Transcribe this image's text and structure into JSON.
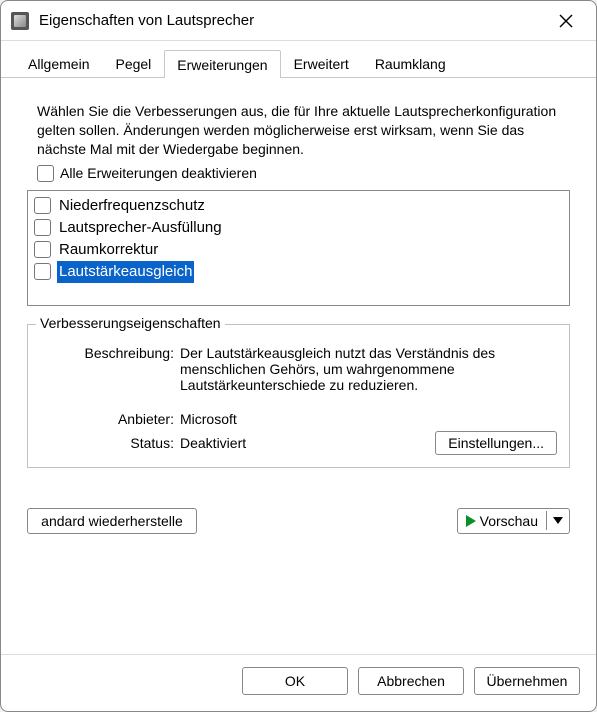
{
  "window": {
    "title": "Eigenschaften von Lautsprecher"
  },
  "tabs": {
    "general": "Allgemein",
    "levels": "Pegel",
    "enhancements": "Erweiterungen",
    "advanced": "Erweitert",
    "spatial": "Raumklang"
  },
  "intro": "Wählen Sie die Verbesserungen aus, die für Ihre aktuelle Lautsprecherkonfiguration gelten sollen. Änderungen werden möglicherweise erst wirksam, wenn Sie das nächste Mal mit der Wiedergabe beginnen.",
  "disable_all_label": "Alle Erweiterungen deaktivieren",
  "enhancements": {
    "0": {
      "label": "Niederfrequenzschutz"
    },
    "1": {
      "label": "Lautsprecher-Ausfüllung"
    },
    "2": {
      "label": "Raumkorrektur"
    },
    "3": {
      "label": "Lautstärkeausgleich"
    }
  },
  "properties": {
    "legend": "Verbesserungseigenschaften",
    "description_label": "Beschreibung:",
    "description_value": "Der Lautstärkeausgleich nutzt das Verständnis des menschlichen Gehörs, um wahrgenommene Lautstärkeunterschiede zu reduzieren.",
    "provider_label": "Anbieter:",
    "provider_value": "Microsoft",
    "status_label": "Status:",
    "status_value": "Deaktiviert",
    "settings_button": "Einstellungen..."
  },
  "actions": {
    "restore_defaults": "andard wiederherstelle",
    "preview": "Vorschau"
  },
  "footer": {
    "ok": "OK",
    "cancel": "Abbrechen",
    "apply": "Übernehmen"
  }
}
